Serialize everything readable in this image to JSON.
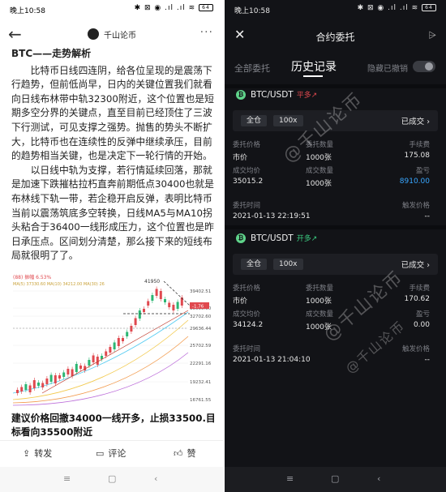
{
  "left": {
    "status": {
      "time": "晚上10:58",
      "icons": "✱ ⊠ ◉ .ıl .ıl ≋",
      "battery": "64"
    },
    "header": {
      "back": "←",
      "account": "千山论币",
      "more": "···"
    },
    "article": {
      "heading": "BTC——走势解析",
      "p1": "比特币日线四连阴，给各位呈现的是震荡下行趋势，但前低尚早，日内的关键位置我们就看向日线布林带中轨32300附近，这个位置也是短期多空分界的关键点，直至目前已经顶住了三波下行测试，可见支撑之强势。抛售的势头不断扩大，比特币也在连续性的反弹中继续承压，目前的趋势相当关键，也是决定下一轮行情的开始。",
      "p2": "以日线中轨为支撑，若行情延续回落，那就是加速下跌摧枯拉朽直奔前期低点30400也就是布林线下轨一带，若企稳开启反弹，表明比特币当前以震荡筑底多空转换，日线MA5与MA10拐头粘合于36400一线形成压力，这个位置也是昨日承压点。区间划分清楚，那么接下来的短线布局就很明了了。"
    },
    "chart_data": {
      "type": "candlestick",
      "legend_line1": "(88) 振幅 6.53%",
      "legend_line2": "MA(5) 37330.60  MA(10) 34212.00  MA(30) 26",
      "price_labels": [
        "39402.51",
        "35000.00",
        "32702.60",
        "29636.44",
        "25702.59",
        "22291.16",
        "19232.41",
        "16761.55"
      ],
      "high_label": "41950",
      "marker": "-1.76",
      "current": "29636.44"
    },
    "summary": "建议价格回撤34000一线开多，止损33500.目标看向35500附近",
    "actions": {
      "share": "转发",
      "comment": "评论",
      "like": "赞"
    },
    "nav": {
      "menu": "≡",
      "home": "▢",
      "back": "‹"
    }
  },
  "right": {
    "status": {
      "time": "晚上10:58",
      "icons": "✱ ⊠ ◉ .ıl .ıl ≋",
      "battery": "64"
    },
    "header": {
      "close": "✕",
      "title": "合约委托",
      "filter": "⩥"
    },
    "tabs": {
      "all": "全部委托",
      "history": "历史记录",
      "hide_cancelled": "隐藏已撤销"
    },
    "watermark": "@千山论币",
    "orders": [
      {
        "pair": "BTC/USDT",
        "side": "平多↗",
        "mode": "全仓",
        "leverage": "100x",
        "state": "已成交 ›",
        "labels": {
          "price": "委托价格",
          "qty": "委托数量",
          "fee": "手续费",
          "avg": "成交均价",
          "filled": "成交数量",
          "pnl": "盈亏",
          "time": "委托时间",
          "trigger": "触发价格"
        },
        "price": "市价",
        "qty": "1000张",
        "fee": "175.08",
        "avg": "35015.2",
        "filled": "1000张",
        "pnl": "8910.00",
        "time": "2021-01-13 22:19:51",
        "trigger": "--"
      },
      {
        "pair": "BTC/USDT",
        "side": "开多↗",
        "mode": "全仓",
        "leverage": "100x",
        "state": "已成交 ›",
        "labels": {
          "price": "委托价格",
          "qty": "委托数量",
          "fee": "手续费",
          "avg": "成交均价",
          "filled": "成交数量",
          "pnl": "盈亏",
          "time": "委托时间",
          "trigger": "触发价格"
        },
        "price": "市价",
        "qty": "1000张",
        "fee": "170.62",
        "avg": "34124.2",
        "filled": "1000张",
        "pnl": "0.00",
        "time": "2021-01-13 21:04:10",
        "trigger": "--"
      }
    ],
    "nav": {
      "menu": "≡",
      "home": "▢",
      "back": "‹"
    }
  }
}
